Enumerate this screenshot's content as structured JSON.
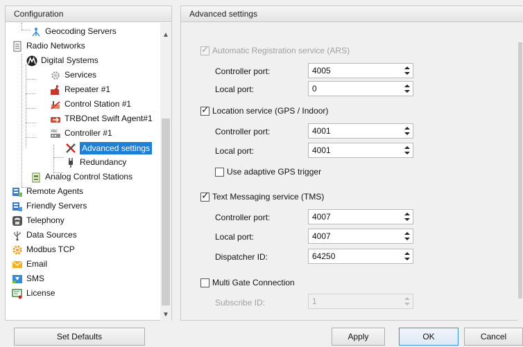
{
  "left_panel": {
    "title": "Configuration",
    "tree": [
      {
        "label": "Geocoding Servers",
        "icon": "geocoding-icon"
      },
      {
        "label": "Radio Networks",
        "icon": "radio-networks-icon"
      },
      {
        "label": "Digital Systems",
        "icon": "motorola-logo-icon"
      },
      {
        "label": "Services",
        "icon": "gear-icon"
      },
      {
        "label": "Repeater #1",
        "icon": "repeater-icon"
      },
      {
        "label": "Control Station #1",
        "icon": "control-station-icon"
      },
      {
        "label": "TRBOnet Swift Agent#1",
        "icon": "swift-agent-icon"
      },
      {
        "label": "Controller #1",
        "icon": "controller-icon"
      },
      {
        "label": "Advanced settings",
        "icon": "tools-icon"
      },
      {
        "label": "Redundancy",
        "icon": "plug-icon"
      },
      {
        "label": "Analog Control Stations",
        "icon": "analog-icon"
      },
      {
        "label": "Remote Agents",
        "icon": "remote-agents-icon"
      },
      {
        "label": "Friendly Servers",
        "icon": "friendly-servers-icon"
      },
      {
        "label": "Telephony",
        "icon": "phone-icon"
      },
      {
        "label": "Data Sources",
        "icon": "usb-icon"
      },
      {
        "label": "Modbus TCP",
        "icon": "modbus-icon"
      },
      {
        "label": "Email",
        "icon": "email-icon"
      },
      {
        "label": "SMS",
        "icon": "sms-icon"
      },
      {
        "label": "License",
        "icon": "license-icon"
      }
    ],
    "selected": "Advanced settings"
  },
  "right_panel": {
    "title": "Advanced settings",
    "ars": {
      "label": "Automatic Registration service (ARS)",
      "checked": true,
      "enabled": false,
      "controller_port_label": "Controller port:",
      "controller_port": "4005",
      "local_port_label": "Local port:",
      "local_port": "0"
    },
    "location": {
      "label": "Location service (GPS / Indoor)",
      "checked": true,
      "controller_port_label": "Controller port:",
      "controller_port": "4001",
      "local_port_label": "Local port:",
      "local_port": "4001",
      "adaptive_label": "Use adaptive GPS trigger",
      "adaptive_checked": false
    },
    "tms": {
      "label": "Text Messaging service (TMS)",
      "checked": true,
      "controller_port_label": "Controller port:",
      "controller_port": "4007",
      "local_port_label": "Local port:",
      "local_port": "4007",
      "dispatcher_label": "Dispatcher ID:",
      "dispatcher_id": "64250"
    },
    "multi_gate": {
      "label": "Multi Gate Connection",
      "checked": false,
      "subscribe_label": "Subscribe ID:",
      "subscribe_id": "1"
    }
  },
  "buttons": {
    "set_defaults": "Set Defaults",
    "apply": "Apply",
    "ok": "OK",
    "cancel": "Cancel"
  },
  "colors": {
    "selection": "#1e7fd6",
    "panel_header": "#e3e3e3",
    "background": "#f0f0f0"
  }
}
